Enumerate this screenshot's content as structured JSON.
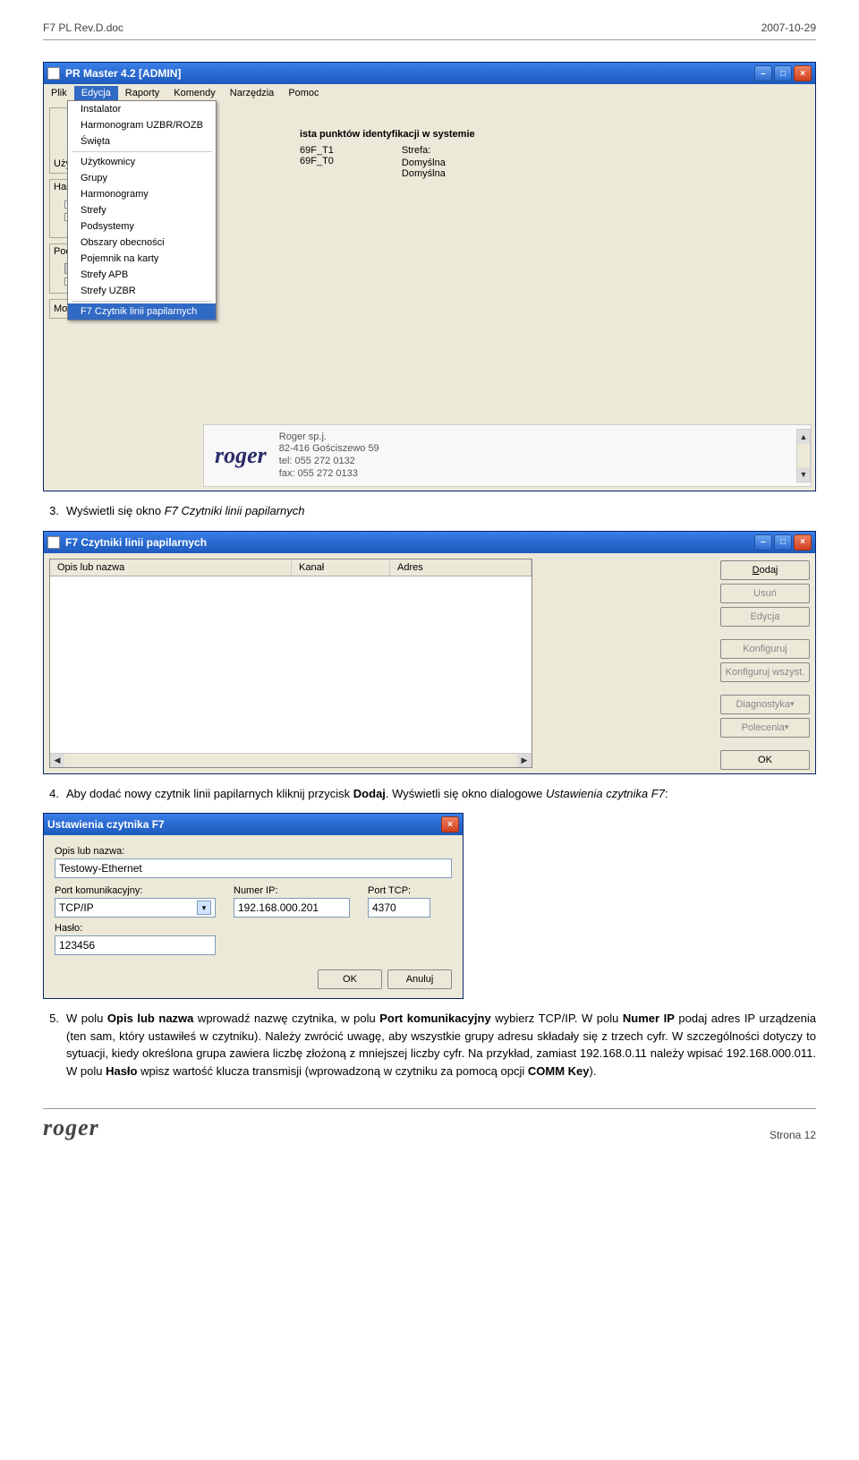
{
  "header": {
    "left": "F7 PL Rev.D.doc",
    "right": "2007-10-29"
  },
  "footer": {
    "logo": "roger",
    "right": "Strona 12"
  },
  "win1": {
    "title": "PR Master 4.2 [ADMIN]",
    "menubar": [
      "Plik",
      "Edycja",
      "Raporty",
      "Komendy",
      "Narzędzia",
      "Pomoc"
    ],
    "open_menu_index": 1,
    "dropdown": {
      "group1": [
        "Instalator",
        "Harmonogram UZBR/ROZB",
        "Święta"
      ],
      "group2": [
        "Użytkownicy",
        "Grupy",
        "Harmonogramy",
        "Strefy",
        "Podsystemy",
        "Obszary obecności",
        "Pojemnik na karty",
        "Strefy APB",
        "Strefy UZBR"
      ],
      "highlight": "F7 Czytnik linii papilarnych"
    },
    "left_panel": {
      "label_uzytkownicy": "Użytkownicy",
      "label_harmonogramy": "Harmonogramy",
      "label_podsystemy": "Podsystemy",
      "label_monitorowanie": "Monitorowanie"
    },
    "right_panel": {
      "title": "ista punktów identyfikacji w systemie",
      "col_strefa": "Strefa:",
      "items": [
        {
          "a": "69F_T1",
          "b": "Domyślna"
        },
        {
          "a": "69F_T0",
          "b": "Domyślna"
        }
      ]
    },
    "logo": {
      "name": "roger",
      "addr1": "Roger sp.j.",
      "addr2": "82-416 Gościszewo 59",
      "tel": "tel: 055 272 0132",
      "fax": "fax: 055 272 0133"
    }
  },
  "para3": {
    "n": "3.",
    "pre": "Wyświetli się okno ",
    "it": "F7 Czytniki linii papilarnych"
  },
  "win2": {
    "title": "F7 Czytniki linii papilarnych",
    "cols": [
      "Opis lub nazwa",
      "Kanał",
      "Adres"
    ],
    "buttons": {
      "dodaj": "Dodaj",
      "usun": "Usuń",
      "edycja": "Edycja",
      "konfiguruj": "Konfiguruj",
      "konfiguruj_wszyst": "Konfiguruj wszyst.",
      "diagnostyka": "Diagnostyka",
      "polecenia": "Polecenia",
      "ok": "OK"
    }
  },
  "para4": {
    "n": "4.",
    "p1": "Aby dodać nowy czytnik linii papilarnych kliknij przycisk ",
    "b1": "Dodaj",
    "p2": ". Wyświetli się okno dialogowe ",
    "it": "Ustawienia czytnika F7",
    "p3": ":"
  },
  "win3": {
    "title": "Ustawienia czytnika F7",
    "labels": {
      "opis": "Opis lub nazwa:",
      "port": "Port komunikacyjny:",
      "numer_ip": "Numer IP:",
      "port_tcp": "Port TCP:",
      "haslo": "Hasło:"
    },
    "values": {
      "opis": "Testowy-Ethernet",
      "port": "TCP/IP",
      "numer_ip": "192.168.000.201",
      "port_tcp": "4370",
      "haslo": "123456"
    },
    "buttons": {
      "ok": "OK",
      "anuluj": "Anuluj"
    }
  },
  "para5": {
    "n": "5.",
    "s1": "W polu ",
    "b1": "Opis lub nazwa",
    "s2": " wprowadź nazwę czytnika, w polu ",
    "b2": "Port komunikacyjny",
    "s3": " wybierz TCP/IP. W polu ",
    "b3": "Numer IP",
    "s4": " podaj adres IP urządzenia (ten sam, który ustawiłeś w czytniku). Należy zwrócić uwagę, aby wszystkie grupy adresu składały się z trzech cyfr. W szczególności dotyczy to sytuacji, kiedy określona grupa zawiera liczbę złożoną z mniejszej liczby cyfr. Na przykład, zamiast 192.168.0.11 należy wpisać 192.168.000.011. W polu ",
    "b4": "Hasło",
    "s5": " wpisz wartość klucza transmisji (wprowadzoną w czytniku za pomocą opcji ",
    "b5": "COMM Key",
    "s6": ")."
  }
}
